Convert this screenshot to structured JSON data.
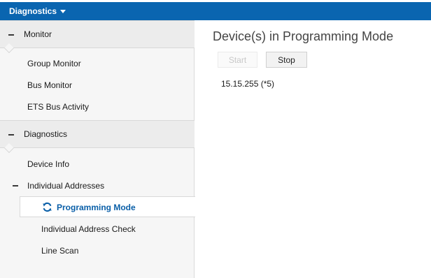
{
  "topbar": {
    "menu_label": "Diagnostics"
  },
  "sidebar": {
    "sections": [
      {
        "label": "Monitor"
      },
      {
        "label": "Diagnostics"
      }
    ],
    "monitor_items": [
      {
        "label": "Group Monitor"
      },
      {
        "label": "Bus Monitor"
      },
      {
        "label": "ETS Bus Activity"
      }
    ],
    "diagnostics_items": {
      "device_info": "Device Info",
      "individual_addresses": "Individual Addresses",
      "programming_mode": "Programming Mode",
      "individual_address_check": "Individual Address Check",
      "line_scan": "Line Scan"
    }
  },
  "main": {
    "title": "Device(s) in Programming Mode",
    "start_label": "Start",
    "stop_label": "Stop",
    "device_entry": "15.15.255 (*5)"
  },
  "colors": {
    "topbar": "#0a65b0",
    "selected_text": "#0a5fa8",
    "sidebar_bg": "#f6f6f6",
    "section_bg": "#ececec"
  },
  "icons": {
    "menu_caret": "caret-down-icon",
    "collapse": "minus-icon",
    "active_item": "refresh-icon"
  }
}
